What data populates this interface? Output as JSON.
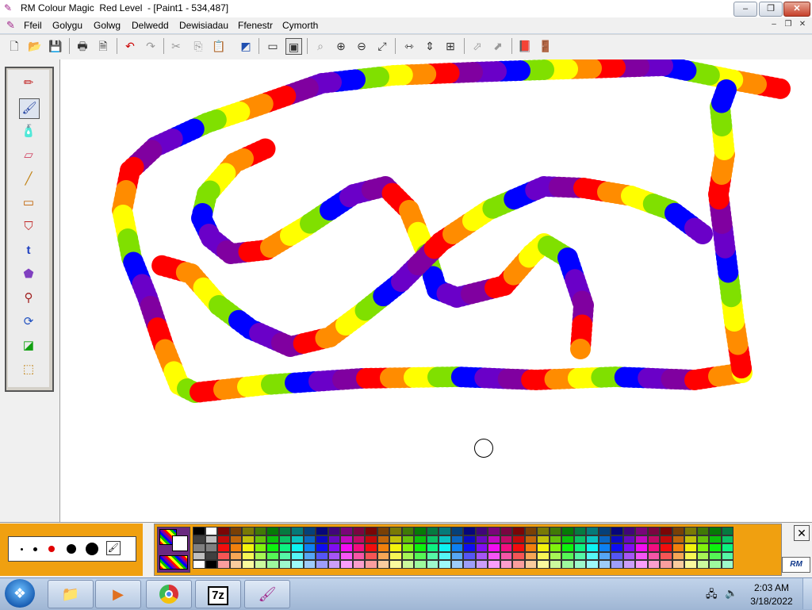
{
  "window": {
    "title": "RM Colour Magic  Red Level  - [Paint1 - 534,487]",
    "min_label": "–",
    "max_label": "❐",
    "close_label": "✕"
  },
  "menu": {
    "items": [
      "Ffeil",
      "Golygu",
      "Golwg",
      "Delwedd",
      "Dewisiadau",
      "Ffenestr",
      "Cymorth"
    ],
    "mdi_min": "–",
    "mdi_restore": "❐",
    "mdi_close": "✕"
  },
  "toolbar": {
    "icons": [
      "new-document-icon",
      "open-folder-icon",
      "save-disk-icon",
      "print-icon",
      "print-preview-icon",
      "undo-icon",
      "redo-icon",
      "cut-icon",
      "copy-icon",
      "paste-icon",
      "select-icon",
      "show-canvas-icon",
      "full-screen-icon",
      "zoom-icon",
      "zoom-in-icon",
      "zoom-out-icon",
      "zoom-fit-icon",
      "flip-horizontal-icon",
      "flip-vertical-icon",
      "rotate-icon",
      "stretch-icon",
      "skew-icon",
      "help-book-icon",
      "exit-door-icon"
    ]
  },
  "tools": {
    "icons": [
      "pencil-icon",
      "brush-icon",
      "spray-can-icon",
      "eraser-icon",
      "line-icon",
      "rectangle-icon",
      "stamp-icon",
      "text-icon",
      "fill-bucket-icon",
      "pipette-icon",
      "shape-icon",
      "color-replace-icon",
      "select-area-icon"
    ],
    "text_tool_label": "t",
    "selected": "brush-icon"
  },
  "colors": {
    "accent": "#f0a010",
    "rainbow": [
      "#ff0000",
      "#ff8c00",
      "#ffff00",
      "#80e000",
      "#0000ff",
      "#6a00c8",
      "#8000a0"
    ]
  },
  "brush": {
    "sizes": [
      "tiny",
      "small",
      "medium",
      "large",
      "xlarge"
    ]
  },
  "taskbar": {
    "time": "2:03 AM",
    "date": "3/18/2022",
    "pinned": [
      "explorer-icon",
      "media-player-icon",
      "chrome-icon",
      "7zip-icon",
      "colour-magic-icon"
    ],
    "zip_label": "7z"
  },
  "rm_logo": "RM"
}
